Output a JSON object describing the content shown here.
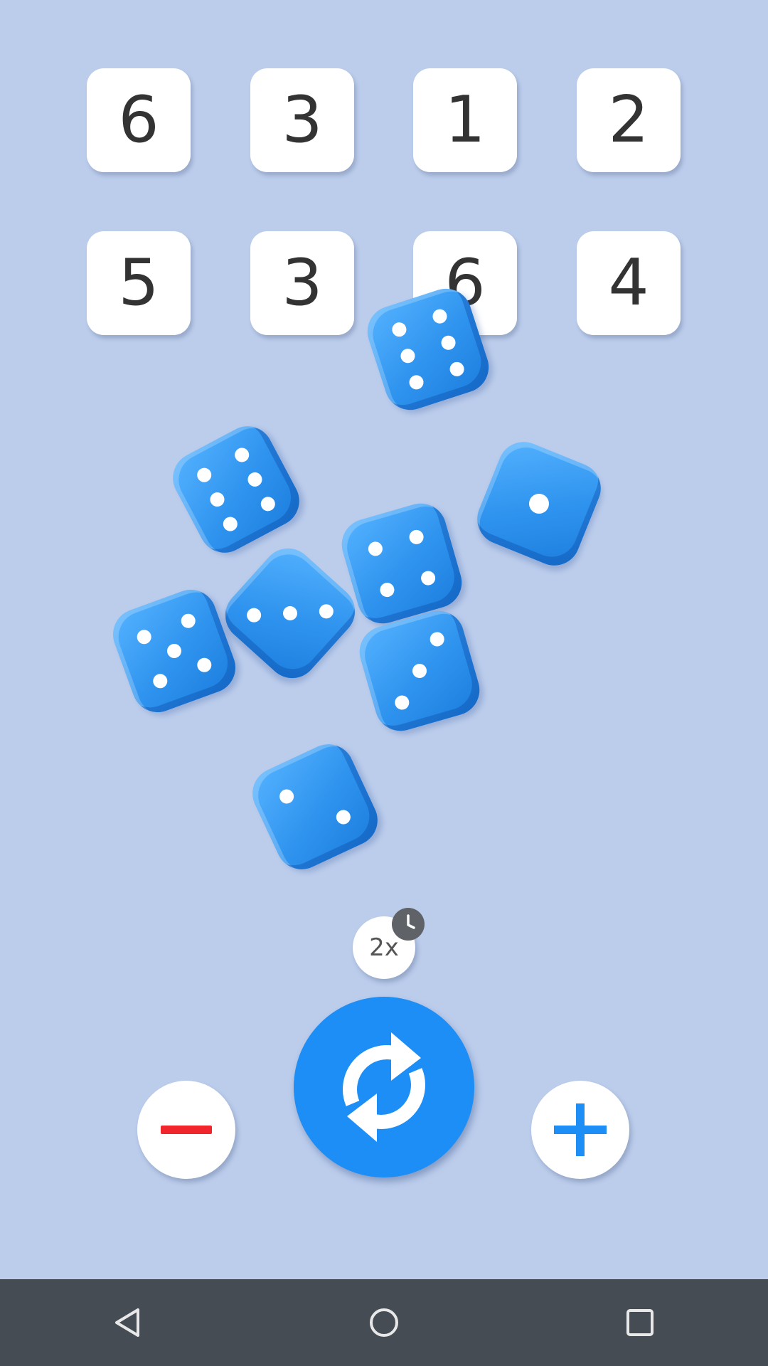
{
  "results": {
    "row1": [
      "6",
      "3",
      "1",
      "2"
    ],
    "row2": [
      "5",
      "3",
      "6",
      "4"
    ]
  },
  "dice": [
    6,
    6,
    1,
    4,
    3,
    5,
    3,
    2
  ],
  "controls": {
    "speed_label": "2x",
    "speed_badge_icon": "clock-icon",
    "decrease_icon": "minus-icon",
    "roll_icon": "refresh-icon",
    "increase_icon": "plus-icon"
  },
  "nav": {
    "back_icon": "back-triangle-icon",
    "home_icon": "home-circle-icon",
    "recents_icon": "recents-square-icon"
  },
  "colors": {
    "background": "#bccdec",
    "die": "#2e93ee",
    "roll_button": "#1c8ef5",
    "decrease": "#f0262c",
    "increase": "#1c8ef5",
    "nav_bar": "#454c54"
  }
}
